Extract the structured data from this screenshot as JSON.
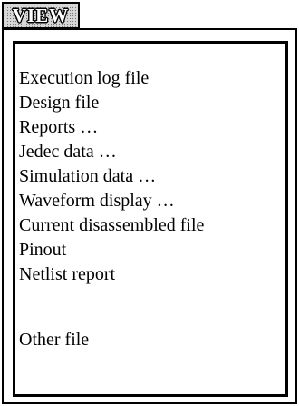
{
  "menu": {
    "title": "VIEW",
    "items": [
      {
        "label": "Execution log file"
      },
      {
        "label": "Design file"
      },
      {
        "label": "Reports …"
      },
      {
        "label": "Jedec data …"
      },
      {
        "label": "Simulation data …"
      },
      {
        "label": "Waveform display …"
      },
      {
        "label": "Current disassembled file"
      },
      {
        "label": "Pinout"
      },
      {
        "label": "Netlist report"
      },
      {
        "label": "Other file"
      }
    ]
  }
}
